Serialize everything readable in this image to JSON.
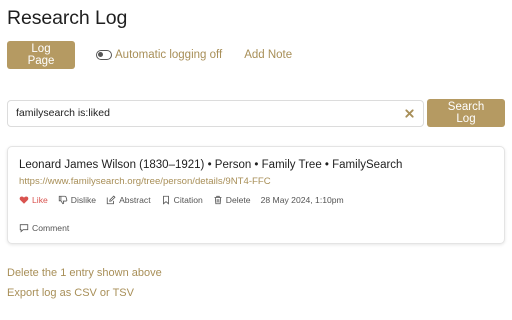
{
  "page": {
    "title": "Research Log"
  },
  "toolbar": {
    "log_page_label": "Log Page",
    "auto_logging_label": "Automatic logging off",
    "add_note_label": "Add Note"
  },
  "search": {
    "query": "familysearch is:liked",
    "button_label": "Search Log"
  },
  "entries": [
    {
      "title": "Leonard James Wilson (1830–1921) • Person • Family Tree • FamilySearch",
      "url": "https://www.familysearch.org/tree/person/details/9NT4-FFC",
      "actions": {
        "like": "Like",
        "dislike": "Dislike",
        "abstract": "Abstract",
        "citation": "Citation",
        "delete": "Delete"
      },
      "timestamp": "28 May 2024, 1:10pm",
      "comment_label": "Comment",
      "liked": true
    }
  ],
  "footer": {
    "delete_label": "Delete the 1 entry shown above",
    "export_label": "Export log as CSV or TSV"
  },
  "colors": {
    "accent": "#b59a62",
    "link": "#a88f58",
    "like": "#d9534f"
  },
  "icons": [
    "toggle-off-icon",
    "clear-icon",
    "heart-icon",
    "thumbs-down-icon",
    "edit-icon",
    "bookmark-icon",
    "trash-icon",
    "comment-icon"
  ]
}
